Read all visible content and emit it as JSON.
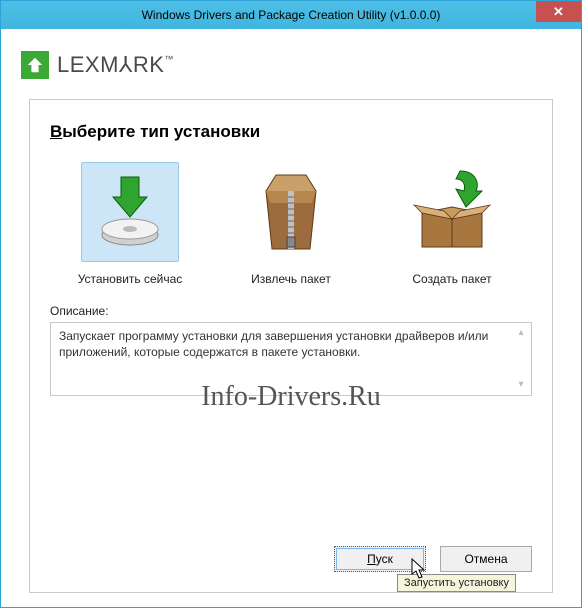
{
  "titlebar": {
    "title": "Windows Drivers and Package Creation Utility (v1.0.0.0)"
  },
  "brand": {
    "name_html": "LEXM⅄RK",
    "trademark": "™"
  },
  "heading": {
    "first_letter": "В",
    "rest": "ыберите тип установки"
  },
  "options": {
    "install": {
      "label": "Установить сейчас"
    },
    "extract": {
      "label": "Извлечь пакет"
    },
    "create": {
      "label": "Создать пакет"
    }
  },
  "description": {
    "label": "Описание:",
    "text": "Запускает программу установки для завершения установки драйверов и/или приложений, которые содержатся в пакете установки."
  },
  "watermark": "Info-Drivers.Ru",
  "buttons": {
    "start_first": "П",
    "start_rest": "уск",
    "cancel": "Отмена"
  },
  "tooltip": "Запустить установку"
}
